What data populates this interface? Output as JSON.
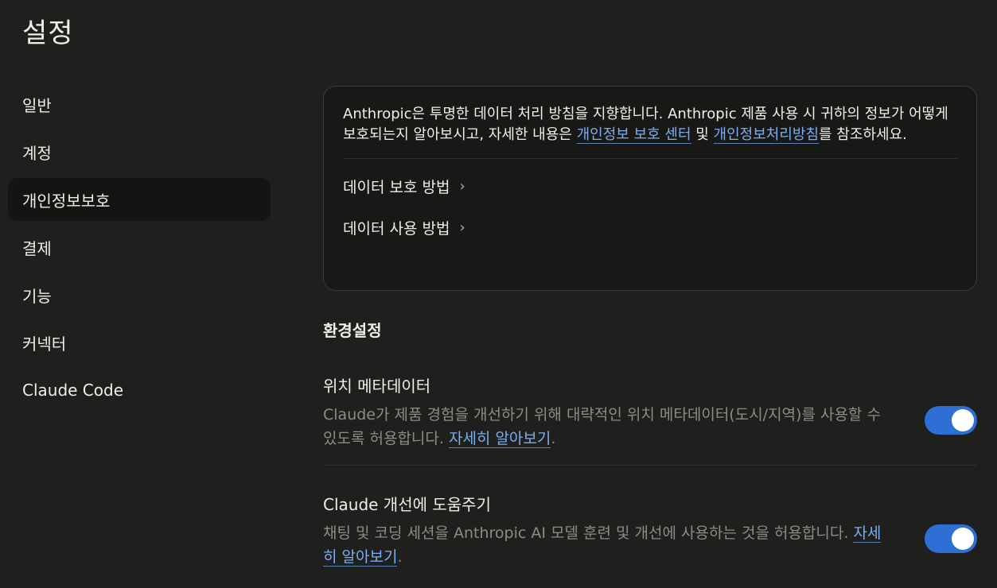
{
  "page": {
    "title": "설정"
  },
  "sidebar": {
    "items": [
      {
        "label": "일반",
        "active": false
      },
      {
        "label": "계정",
        "active": false
      },
      {
        "label": "개인정보보호",
        "active": true
      },
      {
        "label": "결제",
        "active": false
      },
      {
        "label": "기능",
        "active": false
      },
      {
        "label": "커넥터",
        "active": false
      },
      {
        "label": "Claude Code",
        "active": false
      }
    ]
  },
  "info_card": {
    "text_before": "Anthropic은 투명한 데이터 처리 방침을 지향합니다. Anthropic 제품 사용 시 귀하의 정보가 어떻게 보호되는지 알아보시고, 자세한 내용은 ",
    "link1": "개인정보 보호 센터",
    "text_between": " 및 ",
    "link2": "개인정보처리방침",
    "text_after": "를 참조하세요.",
    "links": [
      {
        "label": "데이터 보호 방법",
        "icon": "chevron-right-icon"
      },
      {
        "label": "데이터 사용 방법",
        "icon": "chevron-right-icon"
      }
    ]
  },
  "preferences": {
    "heading": "환경설정",
    "location": {
      "title": "위치 메타데이터",
      "desc": "Claude가 제품 경험을 개선하기 위해 대략적인 위치 메타데이터(도시/지역)를 사용할 수 있도록 허용합니다. ",
      "link": "자세히 알아보기",
      "after": ".",
      "enabled": true
    },
    "improve": {
      "title": "Claude 개선에 도움주기",
      "desc": "채팅 및 코딩 세션을 Anthropic AI 모델 훈련 및 개선에 사용하는 것을 허용합니다. ",
      "link": "자세히 알아보기",
      "after": ".",
      "enabled": true
    }
  },
  "colors": {
    "background": "#1f1f1e",
    "accent": "#2d6fd4",
    "link": "#7aaef0"
  }
}
